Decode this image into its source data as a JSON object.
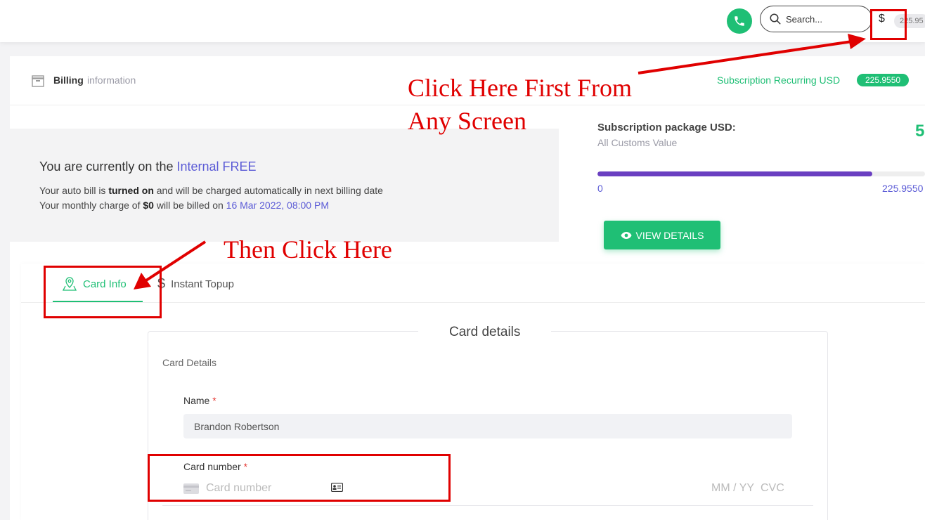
{
  "topbar": {
    "search_placeholder": "Search...",
    "currency_symbol": "$",
    "balance": "225.95"
  },
  "header": {
    "title": "Billing",
    "subtitle": "information",
    "recurring_label": "Subscription Recurring USD",
    "recurring_value": "225.9550"
  },
  "plan": {
    "prefix": "You are currently on the ",
    "plan_name": "Internal FREE",
    "line1_a": "Your auto bill is ",
    "line1_b": "turned on",
    "line1_c": " and will be charged automatically in next billing date",
    "line2_a": "Your monthly charge of ",
    "line2_b": "$0",
    "line2_c": " will be billed on ",
    "line2_date": "16 Mar 2022, 08:00 PM"
  },
  "package": {
    "title": "Subscription package USD:",
    "subtitle": "All Customs Value",
    "big_value": "5",
    "progress_percent": 84,
    "min_label": "0",
    "max_label": "225.9550",
    "view_button": "VIEW DETAILS"
  },
  "tabs": [
    {
      "label": "Card Info",
      "active": true
    },
    {
      "label": "Instant Topup",
      "active": false
    }
  ],
  "card_form": {
    "legend": "Card details",
    "section_label": "Card Details",
    "name_label": "Name",
    "required_mark": "*",
    "name_value": "Brandon Robertson",
    "card_label": "Card number",
    "card_placeholder": "Card number",
    "expiry_placeholder": "MM / YY",
    "cvc_placeholder": "CVC"
  },
  "annotations": {
    "first_line1": "Click Here First From",
    "first_line2": "Any Screen",
    "then": "Then Click Here"
  },
  "colors": {
    "accent_green": "#1fbf75",
    "accent_purple": "#5b5bd6",
    "progress_purple": "#6a3fc1",
    "annotation_red": "#e00000"
  }
}
